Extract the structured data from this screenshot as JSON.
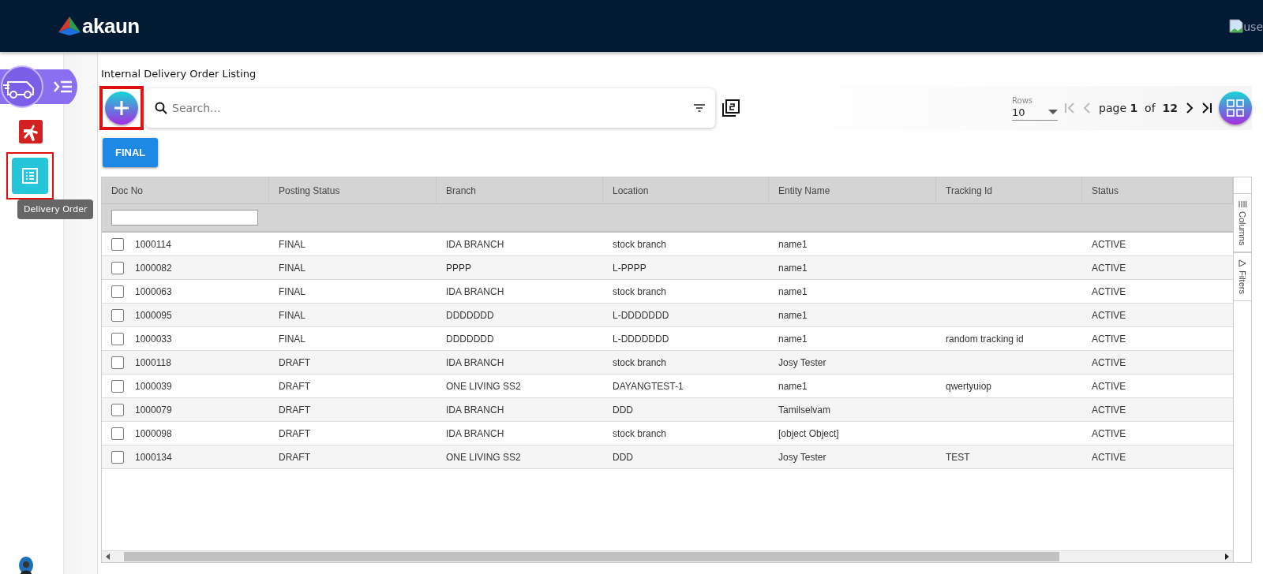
{
  "header": {
    "logo_text": "akaun",
    "user_image_alt": "use"
  },
  "sidebar": {
    "items": [
      {
        "kind": "menu",
        "highlighted": false
      },
      {
        "kind": "app",
        "highlighted": false
      },
      {
        "kind": "document",
        "highlighted": true
      }
    ],
    "tooltip": "Delivery Order"
  },
  "page": {
    "title": "Internal Delivery Order Listing"
  },
  "toolbar": {
    "add_highlighted": true,
    "search": {
      "placeholder": "Search..."
    },
    "filter_chips": [
      {
        "label": "FINAL"
      }
    ]
  },
  "pager": {
    "rows_label": "Rows",
    "rows_value": "10",
    "page_word": "page",
    "page": "1",
    "of_word": "of",
    "total_pages": "12",
    "first_disabled": true,
    "prev_disabled": true,
    "next_disabled": false,
    "last_disabled": false
  },
  "table": {
    "columns": [
      "Doc No",
      "Posting Status",
      "Branch",
      "Location",
      "Entity Name",
      "Tracking Id",
      "Status"
    ],
    "rows": [
      {
        "checked": false,
        "cells": [
          "1000114",
          "FINAL",
          "IDA BRANCH",
          "stock branch",
          "name1",
          "",
          "ACTIVE"
        ]
      },
      {
        "checked": false,
        "cells": [
          "1000082",
          "FINAL",
          "PPPP",
          "L-PPPP",
          "name1",
          "",
          "ACTIVE"
        ]
      },
      {
        "checked": false,
        "cells": [
          "1000063",
          "FINAL",
          "IDA BRANCH",
          "stock branch",
          "name1",
          "",
          "ACTIVE"
        ]
      },
      {
        "checked": false,
        "cells": [
          "1000095",
          "FINAL",
          "DDDDDDD",
          "L-DDDDDDD",
          "name1",
          "",
          "ACTIVE"
        ]
      },
      {
        "checked": false,
        "cells": [
          "1000033",
          "FINAL",
          "DDDDDDD",
          "L-DDDDDDD",
          "name1",
          "random tracking id",
          "ACTIVE"
        ]
      },
      {
        "checked": false,
        "cells": [
          "1000118",
          "DRAFT",
          "IDA BRANCH",
          "stock branch",
          "Josy Tester",
          "",
          "ACTIVE"
        ]
      },
      {
        "checked": false,
        "cells": [
          "1000039",
          "DRAFT",
          "ONE LIVING SS2",
          "DAYANGTEST-1",
          "name1",
          "qwertyuiop",
          "ACTIVE"
        ]
      },
      {
        "checked": false,
        "cells": [
          "1000079",
          "DRAFT",
          "IDA BRANCH",
          "DDD",
          "Tamilselvam",
          "",
          "ACTIVE"
        ]
      },
      {
        "checked": false,
        "cells": [
          "1000098",
          "DRAFT",
          "IDA BRANCH",
          "stock branch",
          "[object Object]",
          "",
          "ACTIVE"
        ]
      },
      {
        "checked": false,
        "cells": [
          "1000134",
          "DRAFT",
          "ONE LIVING SS2",
          "DDD",
          "Josy Tester",
          "TEST",
          "ACTIVE"
        ]
      }
    ],
    "side_tabs": [
      {
        "label": "Columns",
        "kind": "columns"
      },
      {
        "label": "Filters",
        "kind": "filters"
      }
    ]
  }
}
